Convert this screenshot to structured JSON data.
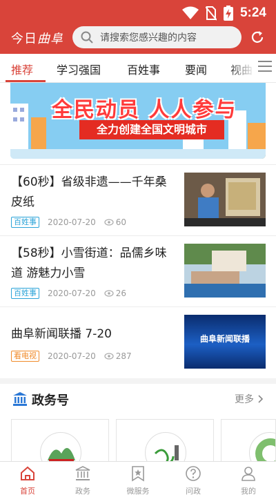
{
  "status_bar": {
    "time": "5:24"
  },
  "app_bar": {
    "logo_prefix": "今日",
    "logo_script": "曲阜",
    "search_placeholder": "请搜索您感兴趣的内容"
  },
  "tabs": [
    {
      "label": "推荐",
      "active": true
    },
    {
      "label": "学习强国"
    },
    {
      "label": "百姓事"
    },
    {
      "label": "要闻"
    },
    {
      "label": "视曲"
    }
  ],
  "banner": {
    "title": "全民动员 人人参与",
    "subtitle": "全力创建全国文明城市"
  },
  "news": [
    {
      "title": "【60秒】省级非遗——千年桑皮纸",
      "tag": "百姓事",
      "tag_color": "#2aa3d8",
      "date": "2020-07-20",
      "views": "60"
    },
    {
      "title": "【58秒】小雪街道：品儒乡味道 游魅力小雪",
      "tag": "百姓事",
      "tag_color": "#2aa3d8",
      "date": "2020-07-20",
      "views": "26"
    },
    {
      "title": "曲阜新闻联播 7-20",
      "tag": "看电视",
      "tag_color": "#f08a28",
      "date": "2020-07-20",
      "views": "287",
      "thumb_text": "曲阜新闻联播"
    }
  ],
  "gov_section": {
    "title": "政务号",
    "more": "更多"
  },
  "bottom_nav": [
    {
      "label": "首页",
      "icon": "home-icon",
      "active": true
    },
    {
      "label": "政务",
      "icon": "government-building-icon"
    },
    {
      "label": "微服务",
      "icon": "bookmark-star-icon"
    },
    {
      "label": "问政",
      "icon": "question-icon"
    },
    {
      "label": "我的",
      "icon": "user-icon"
    }
  ],
  "colors": {
    "brand": "#d9443a",
    "tag_blue": "#2aa3d8",
    "tag_orange": "#f08a28"
  }
}
